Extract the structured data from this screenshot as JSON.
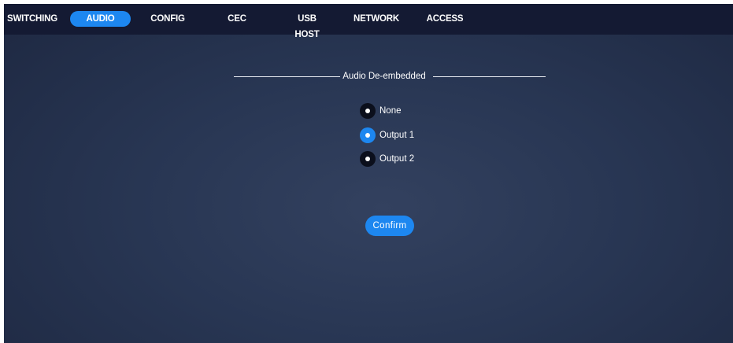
{
  "nav": {
    "items": [
      {
        "label": "SWITCHING"
      },
      {
        "label": "AUDIO",
        "active": true
      },
      {
        "label": "CONFIG"
      },
      {
        "label": "CEC"
      },
      {
        "label": "USB HOST"
      },
      {
        "label": "NETWORK"
      },
      {
        "label": "ACCESS"
      }
    ]
  },
  "section": {
    "title": "Audio De-embedded",
    "options": [
      {
        "label": "None",
        "selected": false
      },
      {
        "label": "Output 1",
        "selected": true
      },
      {
        "label": "Output 2",
        "selected": false
      }
    ],
    "confirm_label": "Confirm"
  },
  "colors": {
    "accent": "#1d87f0",
    "nav_background": "#141a33",
    "page_background": "#283653"
  }
}
